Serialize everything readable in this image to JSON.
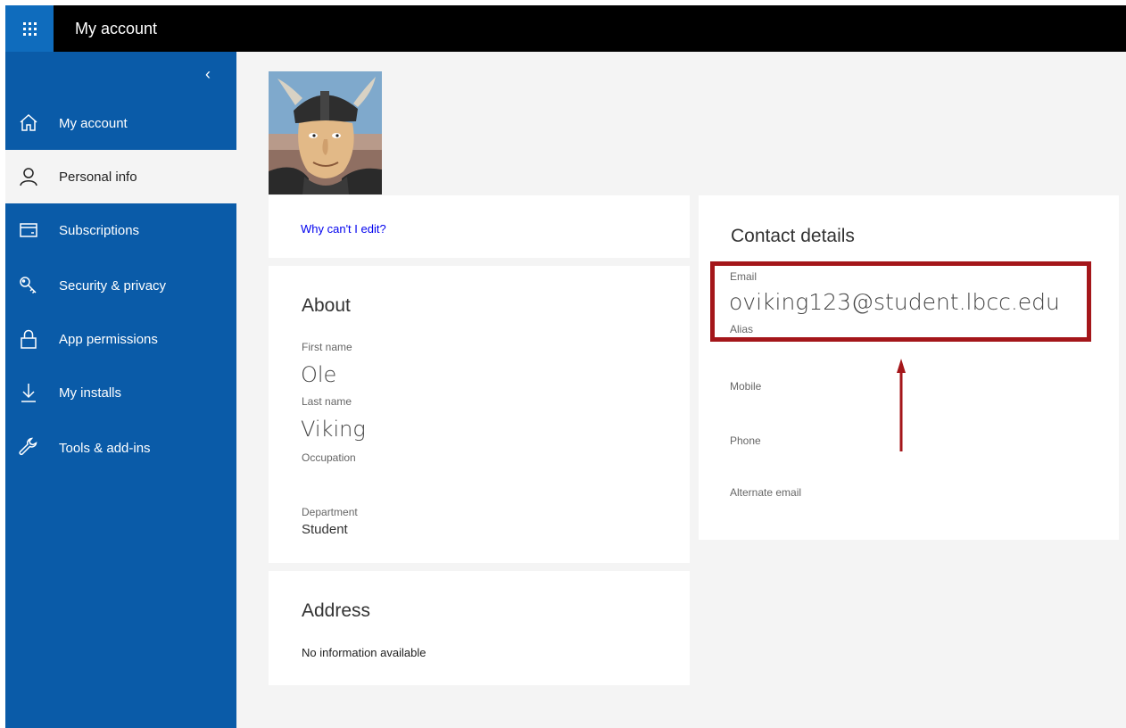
{
  "header": {
    "title": "My account"
  },
  "sidebar": {
    "collapse_glyph": "‹",
    "items": [
      {
        "label": "My account",
        "icon": "home-icon",
        "active": false
      },
      {
        "label": "Personal info",
        "icon": "person-icon",
        "active": true
      },
      {
        "label": "Subscriptions",
        "icon": "card-icon",
        "active": false
      },
      {
        "label": "Security & privacy",
        "icon": "key-icon",
        "active": false
      },
      {
        "label": "App permissions",
        "icon": "lock-icon",
        "active": false
      },
      {
        "label": "My installs",
        "icon": "download-icon",
        "active": false
      },
      {
        "label": "Tools & add-ins",
        "icon": "wrench-icon",
        "active": false
      }
    ]
  },
  "main": {
    "edit_link": "Why can't I edit?",
    "about": {
      "title": "About",
      "first_name_label": "First name",
      "first_name": "Ole",
      "last_name_label": "Last name",
      "last_name": "Viking",
      "occupation_label": "Occupation",
      "department_label": "Department",
      "department": "Student"
    },
    "address": {
      "title": "Address",
      "empty_text": "No information available"
    },
    "contact": {
      "title": "Contact details",
      "email_label": "Email",
      "email": "oviking123@student.lbcc.edu",
      "alias_label": "Alias",
      "mobile_label": "Mobile",
      "phone_label": "Phone",
      "alt_email_label": "Alternate email"
    }
  },
  "annotation": {
    "highlight_color": "#a4161a"
  },
  "colors": {
    "brand_blue": "#0a5ba8",
    "waffle_blue": "#0f6cbd",
    "header_black": "#000000"
  }
}
